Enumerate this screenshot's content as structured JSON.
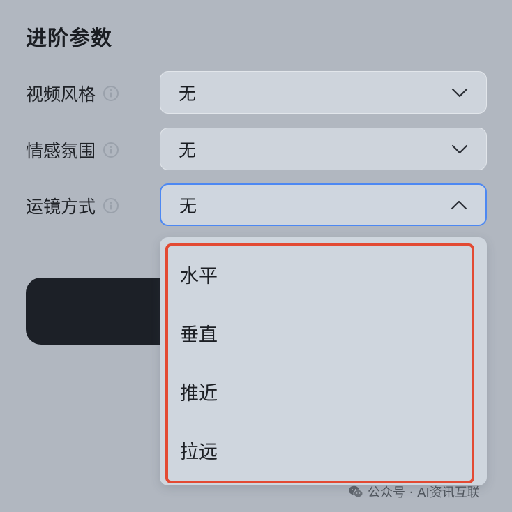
{
  "section": {
    "title": "进阶参数"
  },
  "fields": [
    {
      "label": "视频风格",
      "value": "无",
      "state": "collapsed"
    },
    {
      "label": "情感氛围",
      "value": "无",
      "state": "collapsed"
    },
    {
      "label": "运镜方式",
      "value": "无",
      "state": "open"
    }
  ],
  "dropdown": {
    "options": [
      "水平",
      "垂直",
      "推近",
      "拉远"
    ]
  },
  "watermark": {
    "text": "公众号 · AI资讯互联"
  },
  "colors": {
    "background": "#b1b7c0",
    "select_bg": "#ced4dc",
    "focus_border": "#4d88f2",
    "highlight": "#e34a33",
    "dark_button": "#1c2027"
  },
  "icons": {
    "info": "info-circle-icon",
    "collapsed": "chevron-down-icon",
    "open": "chevron-up-icon",
    "watermark": "wechat-icon"
  }
}
